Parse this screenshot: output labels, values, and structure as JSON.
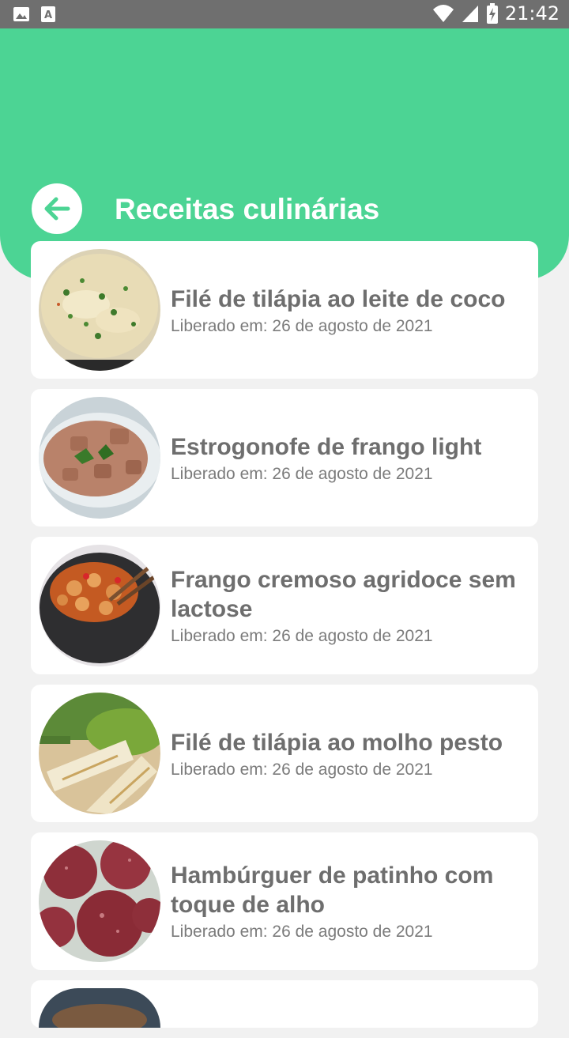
{
  "status_bar": {
    "time": "21:42"
  },
  "header": {
    "title": "Receitas culinárias"
  },
  "recipes": [
    {
      "title": "Filé de tilápia ao leite de coco",
      "released": "Liberado em: 26 de agosto de 2021"
    },
    {
      "title": "Estrogonofe de frango light",
      "released": "Liberado em: 26 de agosto de 2021"
    },
    {
      "title": "Frango cremoso agridoce sem lactose",
      "released": "Liberado em: 26 de agosto de 2021"
    },
    {
      "title": "Filé de tilápia ao molho pesto",
      "released": "Liberado em: 26 de agosto de 2021"
    },
    {
      "title": "Hambúrguer de patinho com toque de alho",
      "released": "Liberado em: 26 de agosto de 2021"
    }
  ],
  "colors": {
    "accent": "#4cd494",
    "status_bar": "#6f6f6f",
    "background": "#f1f1f1"
  }
}
